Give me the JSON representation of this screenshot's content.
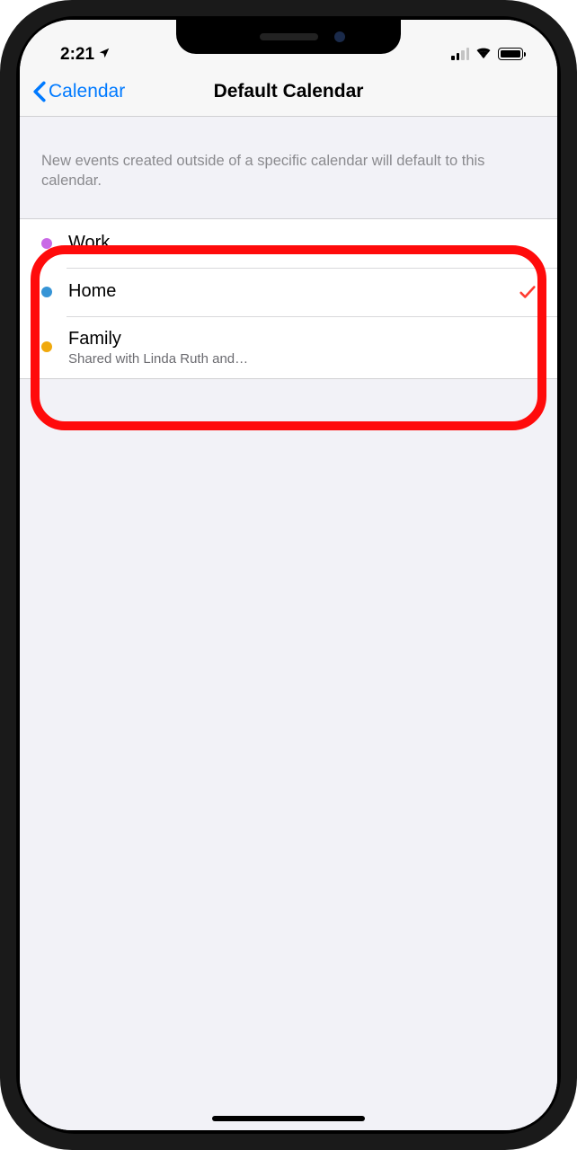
{
  "status": {
    "time": "2:21",
    "location_icon": "location-arrow"
  },
  "nav": {
    "back_label": "Calendar",
    "title": "Default Calendar"
  },
  "section": {
    "description": "New events created outside of a specific calendar will default to this calendar."
  },
  "calendars": [
    {
      "label": "Work",
      "color": "#c969e6",
      "selected": false,
      "subtext": ""
    },
    {
      "label": "Home",
      "color": "#3694d6",
      "selected": true,
      "subtext": ""
    },
    {
      "label": "Family",
      "color": "#f0a90d",
      "selected": false,
      "subtext": "Shared with Linda Ruth and…"
    }
  ]
}
